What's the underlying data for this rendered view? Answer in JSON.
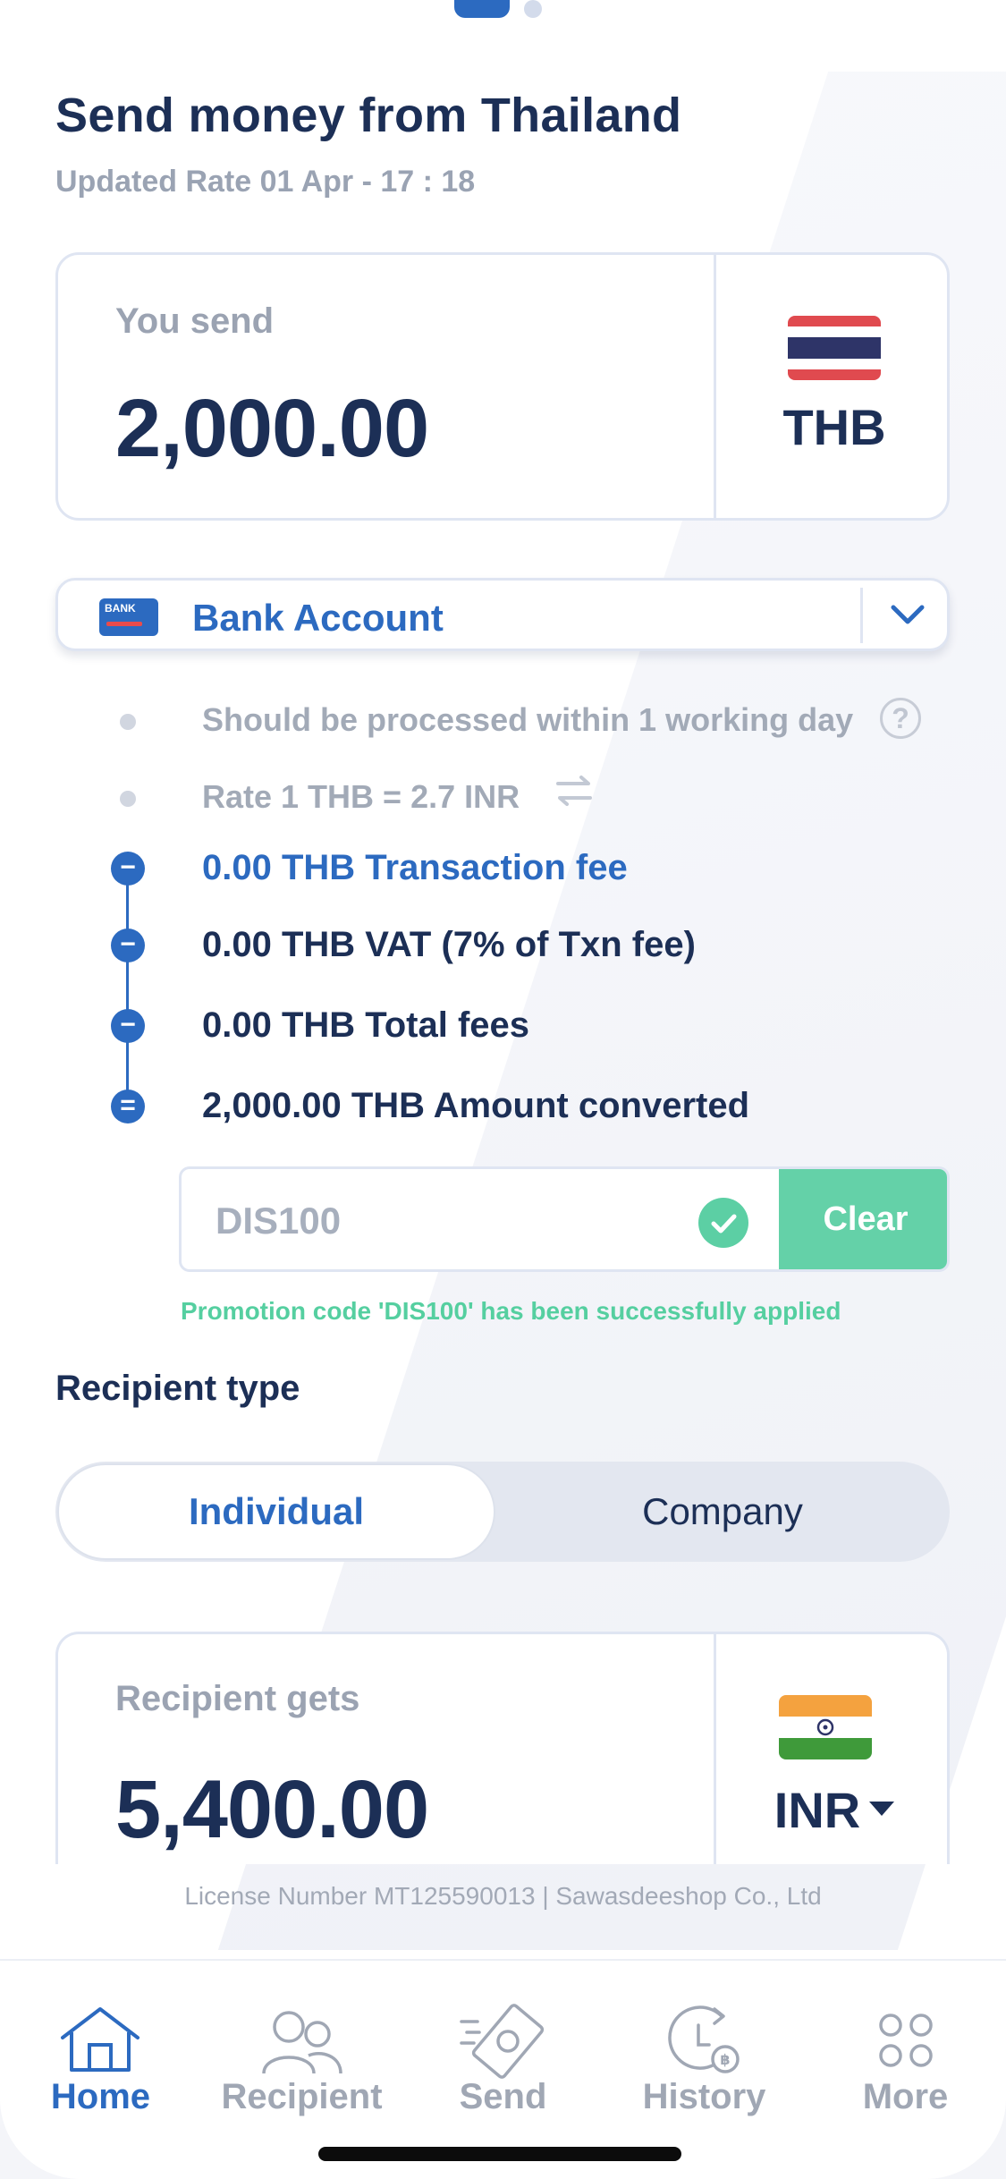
{
  "header": {
    "title": "Send money from Thailand",
    "updated": "Updated Rate 01 Apr - 17 : 18"
  },
  "send": {
    "label": "You send",
    "amount": "2,000.00",
    "currency": "THB"
  },
  "method": {
    "card_text": "BANK",
    "label": "Bank Account"
  },
  "info": {
    "processing": "Should be processed within 1 working day",
    "help": "?",
    "rate": "Rate 1 THB = 2.7 INR"
  },
  "fees": [
    {
      "symbol": "−",
      "text": "0.00 THB Transaction fee"
    },
    {
      "symbol": "−",
      "text": "0.00 THB VAT (7% of Txn fee)"
    },
    {
      "symbol": "−",
      "text": "0.00 THB Total fees"
    },
    {
      "symbol": "=",
      "text": "2,000.00 THB Amount converted"
    }
  ],
  "promo": {
    "code": "DIS100",
    "clear_label": "Clear",
    "message": "Promotion code 'DIS100' has been successfully applied"
  },
  "recipient_type": {
    "label": "Recipient type",
    "options": [
      "Individual",
      "Company"
    ],
    "selected": "Individual"
  },
  "receive": {
    "label": "Recipient gets",
    "amount": "5,400.00",
    "currency": "INR"
  },
  "footer": {
    "license": "License Number MT125590013 | Sawasdeeshop Co., Ltd"
  },
  "tabs": [
    {
      "label": "Home",
      "icon": "home-icon",
      "active": true
    },
    {
      "label": "Recipient",
      "icon": "users-icon",
      "active": false
    },
    {
      "label": "Send",
      "icon": "money-icon",
      "active": false
    },
    {
      "label": "History",
      "icon": "history-icon",
      "active": false
    },
    {
      "label": "More",
      "icon": "grid-icon",
      "active": false
    }
  ],
  "colors": {
    "primary": "#2c6ac0",
    "navy": "#1c2f56",
    "success": "#64d1a8"
  }
}
